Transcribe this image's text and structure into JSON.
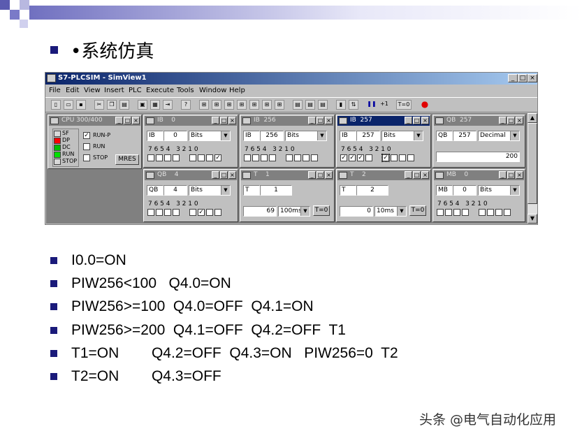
{
  "slide": {
    "title": "•系统仿真",
    "watermark": "头条 @电气自动化应用",
    "bullets": [
      "I0.0=ON",
      "PIW256<100   Q4.0=ON",
      "PIW256>=100  Q4.0=OFF  Q4.1=ON",
      "PIW256>=200  Q4.1=OFF  Q4.2=OFF  T1",
      "T1=ON        Q4.2=OFF  Q4.3=ON   PIW256=0  T2",
      "T2=ON        Q4.3=OFF"
    ],
    "colors": {
      "bullet": "#1a1a7a",
      "title_bar": "#0a246a"
    }
  },
  "sim": {
    "title": "S7-PLCSIM - SimView1",
    "window_buttons": [
      "_",
      "□",
      "×"
    ],
    "menu": [
      "File",
      "Edit",
      "View",
      "Insert",
      "PLC",
      "Execute",
      "Tools",
      "Window",
      "Help"
    ],
    "toolbar": {
      "run_label": "+1",
      "t0_label": "T=0"
    },
    "cpu": {
      "title": "CPU 300/400",
      "leds": [
        {
          "label": "SF",
          "color": "#d8d8d8"
        },
        {
          "label": "DP",
          "color": "#ff0000"
        },
        {
          "label": "DC",
          "color": "#00c000"
        },
        {
          "label": "RUN",
          "color": "#00e000"
        },
        {
          "label": "STOP",
          "color": "#d8d8d8"
        }
      ],
      "modes": [
        {
          "label": "RUN-P",
          "checked": true
        },
        {
          "label": "RUN",
          "checked": false
        },
        {
          "label": "STOP",
          "checked": false
        }
      ],
      "mres": "MRES"
    },
    "ib0": {
      "title": "IB    0",
      "area": "IB",
      "addr": "0",
      "format": "Bits",
      "bits_label": "7 6 5 4   3 2 1 0",
      "bits": [
        0,
        0,
        0,
        0,
        0,
        0,
        0,
        1
      ]
    },
    "ib256": {
      "title": "IB  256",
      "area": "IB",
      "addr": "256",
      "format": "Bits",
      "bits_label": "7 6 5 4   3 2 1 0",
      "bits": [
        0,
        0,
        0,
        0,
        0,
        0,
        0,
        0
      ]
    },
    "ib257": {
      "title": "IB  257",
      "area": "IB",
      "addr": "257",
      "format": "Bits",
      "bits_label": "7 6 5 4   3 2 1 0",
      "bits": [
        1,
        1,
        1,
        0,
        1,
        0,
        0,
        0
      ]
    },
    "qb257": {
      "title": "QB  257",
      "area": "QB",
      "addr": "257",
      "format": "Decimal",
      "value": "200"
    },
    "qb4": {
      "title": "QB    4",
      "area": "QB",
      "addr": "4",
      "format": "Bits",
      "bits_label": "7 6 5 4   3 2 1 0",
      "bits": [
        0,
        0,
        0,
        0,
        0,
        1,
        0,
        0
      ]
    },
    "t1": {
      "title": "T    1",
      "area": "T",
      "addr": "1",
      "value": "69",
      "base": "100ms",
      "reset": "T=0"
    },
    "t2": {
      "title": "T    2",
      "area": "T",
      "addr": "2",
      "value": "0",
      "base": "10ms",
      "reset": "T=0"
    },
    "mb0": {
      "title": "MB    0",
      "area": "MB",
      "addr": "0",
      "format": "Bits",
      "bits_label": "7 6 5 4   3 2 1 0",
      "bits": [
        0,
        0,
        0,
        0,
        0,
        0,
        0,
        0
      ]
    }
  }
}
